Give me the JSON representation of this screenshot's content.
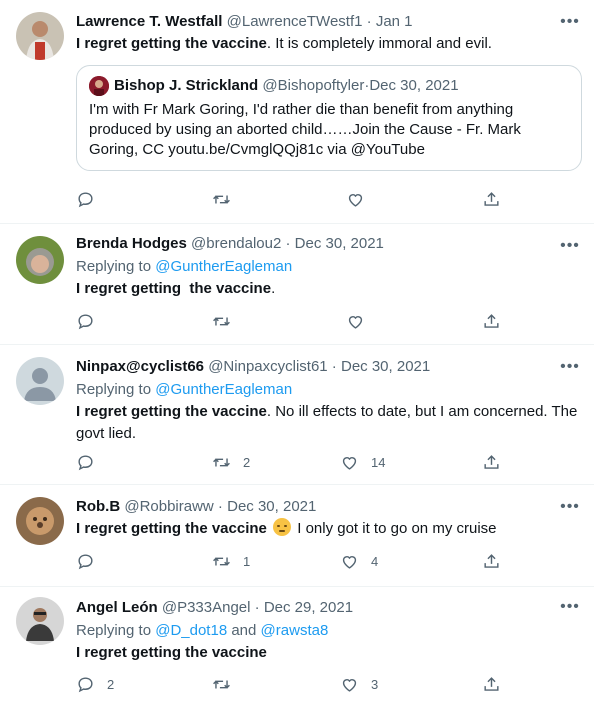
{
  "tweets": [
    {
      "name": "Lawrence T. Westfall",
      "handle": "@LawrenceTWestf1",
      "date": "Jan 1",
      "text_bold": "I regret getting the vaccine",
      "text_rest": ". It is completely immoral and evil.",
      "quote": {
        "name": "Bishop J. Strickland",
        "handle": "@Bishopoftyler",
        "date": "Dec 30, 2021",
        "text": "I'm with Fr Mark Goring, I'd rather die than benefit from anything produced by using an aborted child……Join the Cause - Fr. Mark Goring, CC youtu.be/CvmglQQj81c via @YouTube"
      },
      "counts": {
        "reply": "",
        "retweet": "",
        "like": ""
      }
    },
    {
      "name": "Brenda Hodges",
      "handle": "@brendalou2",
      "date": "Dec 30, 2021",
      "replying_prefix": "Replying to ",
      "replying_to": "@GuntherEagleman",
      "text_bold": "I regret getting  the vaccine",
      "text_rest": ".",
      "counts": {
        "reply": "",
        "retweet": "",
        "like": ""
      }
    },
    {
      "name": "Ninpax@cyclist66",
      "handle": "@Ninpaxcyclist61",
      "date": "Dec 30, 2021",
      "replying_prefix": "Replying to ",
      "replying_to": "@GuntherEagleman",
      "text_bold": "I regret getting the vaccine",
      "text_rest": ". No ill effects to date, but I am concerned. The govt lied.",
      "counts": {
        "reply": "",
        "retweet": "2",
        "like": "14"
      }
    },
    {
      "name": "Rob.B",
      "handle": "@Robbiraww",
      "date": "Dec 30, 2021",
      "text_bold": "I regret getting the vaccine",
      "text_rest": " I only got it to go on my cruise",
      "emoji": "unamused-face-emoji",
      "counts": {
        "reply": "",
        "retweet": "1",
        "like": "4"
      }
    },
    {
      "name": "Angel León",
      "handle": "@P333Angel",
      "date": "Dec 29, 2021",
      "replying_prefix": "Replying to ",
      "replying_to": "@D_dot18",
      "replying_and": " and ",
      "replying_to2": "@rawsta8",
      "text_bold": "I regret getting the vaccine",
      "text_rest": "",
      "counts": {
        "reply": "2",
        "retweet": "",
        "like": "3"
      }
    }
  ],
  "separator": " · ",
  "more_label": "•••",
  "colors": {
    "link": "#1d9bf0",
    "secondary": "#536471",
    "border": "#eff3f4"
  }
}
